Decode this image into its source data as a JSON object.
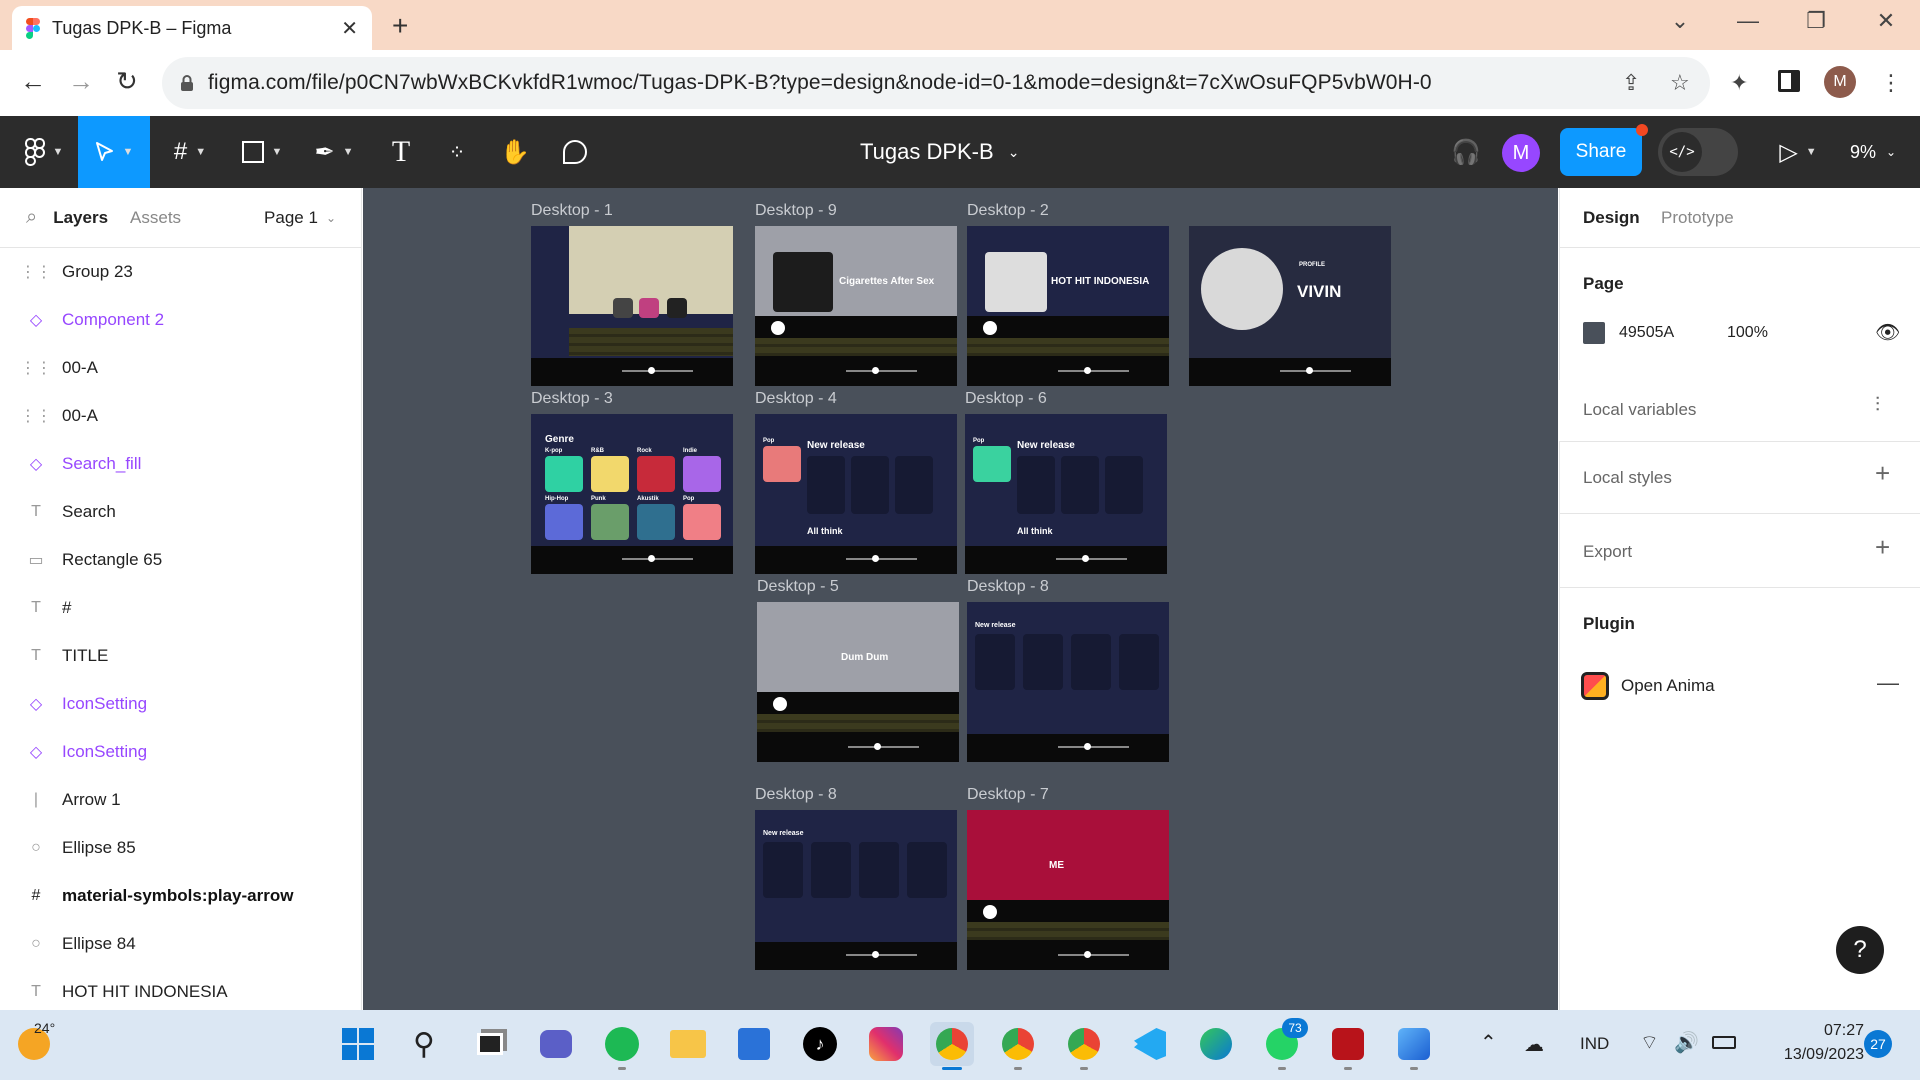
{
  "browser": {
    "tab_title": "Tugas DPK-B – Figma",
    "url": "figma.com/file/p0CN7wbWxBCKvkfdR1wmoc/Tugas-DPK-B?type=design&node-id=0-1&mode=design&t=7cXwOsuFQP5vbW0H-0",
    "profile_initial": "M"
  },
  "figma": {
    "doc_title": "Tugas DPK-B",
    "avatar_initial": "M",
    "share_label": "Share",
    "zoom": "9%",
    "dev_mode_label": "</>"
  },
  "left_panel": {
    "tabs": [
      "Layers",
      "Assets"
    ],
    "page": "Page 1",
    "layers": [
      {
        "icon": "group",
        "name": "Group 23"
      },
      {
        "icon": "component",
        "name": "Component 2"
      },
      {
        "icon": "group",
        "name": "00-A"
      },
      {
        "icon": "group",
        "name": "00-A"
      },
      {
        "icon": "component",
        "name": "Search_fill"
      },
      {
        "icon": "text",
        "name": "Search"
      },
      {
        "icon": "rectangle",
        "name": "Rectangle 65"
      },
      {
        "icon": "text",
        "name": "#"
      },
      {
        "icon": "text",
        "name": "TITLE"
      },
      {
        "icon": "component",
        "name": "IconSetting"
      },
      {
        "icon": "component",
        "name": "IconSetting"
      },
      {
        "icon": "line",
        "name": "Arrow 1"
      },
      {
        "icon": "ellipse",
        "name": "Ellipse 85"
      },
      {
        "icon": "frame",
        "name": "material-symbols:play-arrow"
      },
      {
        "icon": "ellipse",
        "name": "Ellipse 84"
      },
      {
        "icon": "text",
        "name": "HOT HIT INDONESIA"
      }
    ]
  },
  "canvas": {
    "background": "#49505A",
    "frames": {
      "d1": {
        "label": "Desktop - 1"
      },
      "d9": {
        "label": "Desktop - 9",
        "artist_title": "Cigarettes After Sex"
      },
      "d2": {
        "label": "Desktop - 2",
        "playlist_title": "HOT HIT INDONESIA"
      },
      "profile": {
        "name": "VIVIN",
        "tag": "PROFILE"
      },
      "d3": {
        "label": "Desktop - 3",
        "heading": "Genre",
        "genres": [
          "K-pop",
          "R&B",
          "Rock",
          "Indie",
          "Hip-Hop",
          "Punk",
          "Akustik",
          "Pop"
        ]
      },
      "d4": {
        "label": "Desktop - 4",
        "section1": "New release",
        "section2": "All think",
        "tag": "Pop"
      },
      "d6": {
        "label": "Desktop - 6",
        "section1": "New release",
        "section2": "All think",
        "tag": "Pop"
      },
      "d5": {
        "label": "Desktop - 5",
        "song_title": "Dum Dum"
      },
      "d8a": {
        "label": "Desktop - 8",
        "section": "New release"
      },
      "d8b": {
        "label": "Desktop - 8",
        "section": "New release"
      },
      "d7": {
        "label": "Desktop - 7",
        "title": "ME"
      }
    }
  },
  "right_panel": {
    "tabs": [
      "Design",
      "Prototype"
    ],
    "page_title": "Page",
    "page_color": "49505A",
    "page_opacity": "100%",
    "local_variables": "Local variables",
    "local_styles": "Local styles",
    "export": "Export",
    "plugin_title": "Plugin",
    "plugin_name": "Open Anima"
  },
  "taskbar": {
    "weather": "24°",
    "language": "IND",
    "time": "07:27",
    "date": "13/09/2023",
    "notifications": "27",
    "whatsapp_badge": "73"
  }
}
